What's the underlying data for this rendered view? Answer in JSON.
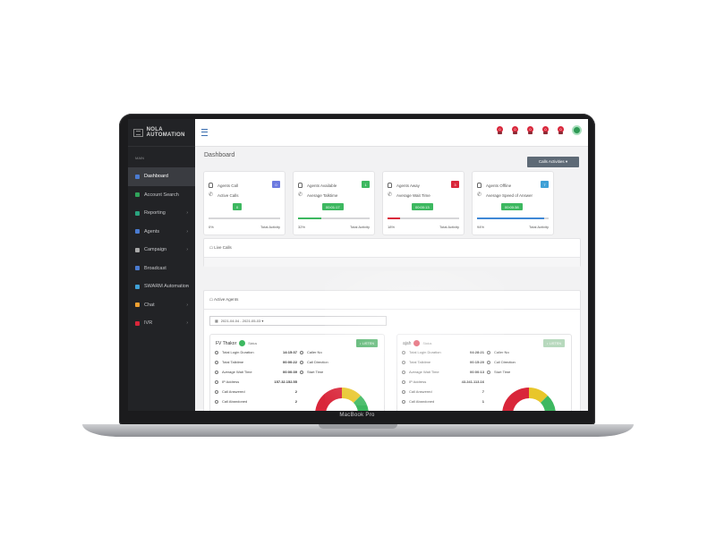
{
  "device": {
    "brand": "MacBook Pro"
  },
  "app": {
    "title": "NOLA AUTOMATION"
  },
  "sidebar": {
    "section_label": "MAIN",
    "items": [
      {
        "label": "Dashboard",
        "icon": "home-icon",
        "active": true,
        "color": "#4a7bd0"
      },
      {
        "label": "Account Search",
        "icon": "search-icon",
        "color": "#30a35a"
      },
      {
        "label": "Reporting",
        "icon": "report-icon",
        "color": "#2aa37f",
        "chevron": "›"
      },
      {
        "label": "Agents",
        "icon": "users-icon",
        "color": "#4a7bd0",
        "chevron": "›"
      },
      {
        "label": "Campaign",
        "icon": "campaign-icon",
        "color": "#a9a9a9",
        "chevron": "›"
      },
      {
        "label": "Broadcast",
        "icon": "broadcast-icon",
        "color": "#4a7bd0"
      },
      {
        "label": "SWARM Automation",
        "icon": "automation-icon",
        "color": "#3fa0d6",
        "chevron": "›"
      },
      {
        "label": "Chat",
        "icon": "chat-icon",
        "color": "#f0a030",
        "chevron": "›"
      },
      {
        "label": "IVR",
        "icon": "ivr-icon",
        "color": "#d9263a",
        "chevron": "›"
      }
    ]
  },
  "topbar": {
    "badges": [
      "0",
      "0",
      "0",
      "0",
      "0"
    ]
  },
  "page": {
    "title": "Dashboard",
    "calls_button": "Calls Activities ▾"
  },
  "cards": [
    {
      "line1": "Agents Call",
      "badge": "0",
      "badge_color": "#6c7ae0",
      "line2": "Active Calls",
      "pill": "0",
      "progress": 0,
      "fill_color": "#3db860",
      "pct": "0%",
      "footer": "Total Activity"
    },
    {
      "line1": "Agents Available",
      "badge": "1",
      "badge_color": "#3db860",
      "line2": "Average Talktime",
      "pill": "00:01:17",
      "progress": 32,
      "fill_color": "#3db860",
      "pct": "32%",
      "footer": "Total Activity"
    },
    {
      "line1": "Agents Away",
      "badge": "3",
      "badge_color": "#d9263a",
      "line2": "Average Wait Time",
      "pill": "00:00:13",
      "progress": 18,
      "fill_color": "#d9263a",
      "pct": "18%",
      "footer": "Total Activity"
    },
    {
      "line1": "Agents Offline",
      "badge": "7",
      "badge_color": "#3fa0d6",
      "line2": "Average Speed of Answer",
      "pill": "00:00:38",
      "progress": 94,
      "fill_color": "#3f88d6",
      "pct": "94%",
      "footer": "Total Activity"
    }
  ],
  "live_calls": {
    "title": "Live Calls"
  },
  "active_agents": {
    "title": "Active Agents",
    "date_range": "2021-04-04 - 2021-05-03 ▾"
  },
  "agents": [
    {
      "name": "FV Thakor",
      "status": "Status",
      "status_color": "#3db860",
      "listen": "LISTEN",
      "stats": [
        {
          "label": "Total Login Duration",
          "value": "14:15:37"
        },
        {
          "label": "Total Talktime",
          "value": "00:00:22"
        },
        {
          "label": "Average Wait Time",
          "value": "00:00:39"
        },
        {
          "label": "IP Address",
          "value": "157.32.152.55"
        },
        {
          "label": "Call Answered",
          "value": "2"
        },
        {
          "label": "Call Abandoned",
          "value": "2"
        }
      ],
      "call_info": [
        "Caller No",
        "Call Direction",
        "Start Time"
      ]
    },
    {
      "name": "ajah",
      "status": "Status",
      "status_color": "#d9263a",
      "listen": "LISTEN",
      "stats": [
        {
          "label": "Total Login Duration",
          "value": "04:28:21"
        },
        {
          "label": "Total Talktime",
          "value": "00:15:20"
        },
        {
          "label": "Average Wait Time",
          "value": "00:00:13"
        },
        {
          "label": "IP Address",
          "value": "43.241.113.16"
        },
        {
          "label": "Call Answered",
          "value": "7"
        },
        {
          "label": "Call Abandoned",
          "value": "1"
        }
      ],
      "call_info": [
        "Caller No",
        "Call Direction",
        "Start Time"
      ]
    }
  ]
}
